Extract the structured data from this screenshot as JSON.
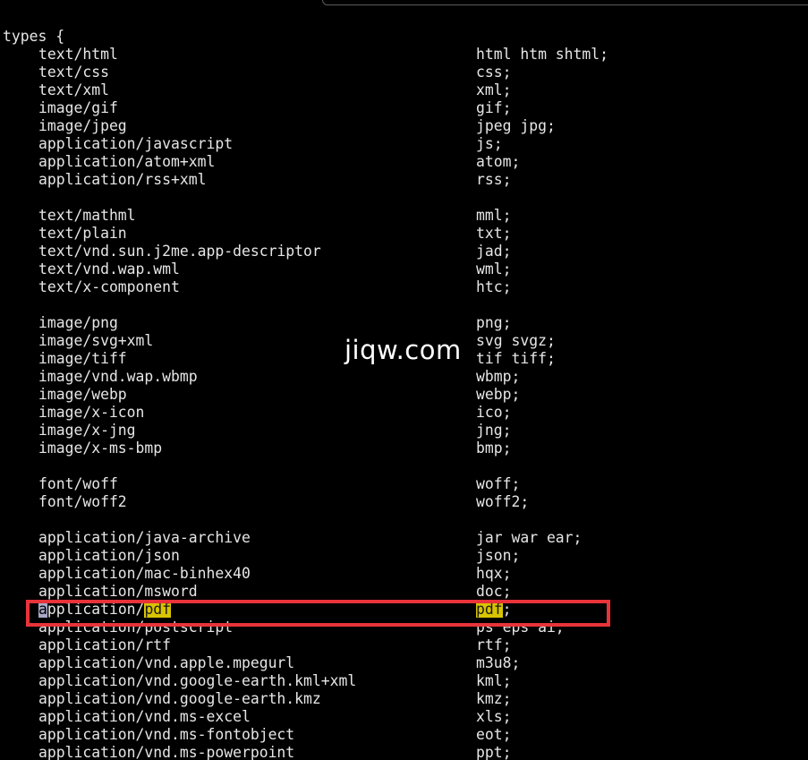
{
  "header_line": "types {",
  "highlight_color": "#e8333a",
  "match_color": "#d7c400",
  "watermark": "jiqw.com",
  "entries": [
    {
      "type": "text/html",
      "ext": "html htm shtml;"
    },
    {
      "type": "text/css",
      "ext": "css;"
    },
    {
      "type": "text/xml",
      "ext": "xml;"
    },
    {
      "type": "image/gif",
      "ext": "gif;"
    },
    {
      "type": "image/jpeg",
      "ext": "jpeg jpg;"
    },
    {
      "type": "application/javascript",
      "ext": "js;"
    },
    {
      "type": "application/atom+xml",
      "ext": "atom;"
    },
    {
      "type": "application/rss+xml",
      "ext": "rss;"
    },
    {
      "type": "",
      "ext": ""
    },
    {
      "type": "text/mathml",
      "ext": "mml;"
    },
    {
      "type": "text/plain",
      "ext": "txt;"
    },
    {
      "type": "text/vnd.sun.j2me.app-descriptor",
      "ext": "jad;"
    },
    {
      "type": "text/vnd.wap.wml",
      "ext": "wml;"
    },
    {
      "type": "text/x-component",
      "ext": "htc;"
    },
    {
      "type": "",
      "ext": ""
    },
    {
      "type": "image/png",
      "ext": "png;"
    },
    {
      "type": "image/svg+xml",
      "ext": "svg svgz;"
    },
    {
      "type": "image/tiff",
      "ext": "tif tiff;"
    },
    {
      "type": "image/vnd.wap.wbmp",
      "ext": "wbmp;"
    },
    {
      "type": "image/webp",
      "ext": "webp;"
    },
    {
      "type": "image/x-icon",
      "ext": "ico;"
    },
    {
      "type": "image/x-jng",
      "ext": "jng;"
    },
    {
      "type": "image/x-ms-bmp",
      "ext": "bmp;"
    },
    {
      "type": "",
      "ext": ""
    },
    {
      "type": "font/woff",
      "ext": "woff;"
    },
    {
      "type": "font/woff2",
      "ext": "woff2;"
    },
    {
      "type": "",
      "ext": ""
    },
    {
      "type": "application/java-archive",
      "ext": "jar war ear;"
    },
    {
      "type": "application/json",
      "ext": "json;"
    },
    {
      "type": "application/mac-binhex40",
      "ext": "hqx;"
    },
    {
      "type": "application/msword",
      "ext": "doc;"
    }
  ],
  "selected_entry": {
    "cursor_char": "a",
    "type_rest": "pplication/",
    "type_match": "pdf",
    "ext_match": "pdf",
    "ext_rest": ";"
  },
  "entries_after": [
    {
      "type": "application/postscript",
      "ext": "ps eps ai;"
    },
    {
      "type": "application/rtf",
      "ext": "rtf;"
    },
    {
      "type": "application/vnd.apple.mpegurl",
      "ext": "m3u8;"
    },
    {
      "type": "application/vnd.google-earth.kml+xml",
      "ext": "kml;"
    },
    {
      "type": "application/vnd.google-earth.kmz",
      "ext": "kmz;"
    },
    {
      "type": "application/vnd.ms-excel",
      "ext": "xls;"
    },
    {
      "type": "application/vnd.ms-fontobject",
      "ext": "eot;"
    },
    {
      "type": "application/vnd.ms-powerpoint",
      "ext": "ppt;"
    }
  ]
}
